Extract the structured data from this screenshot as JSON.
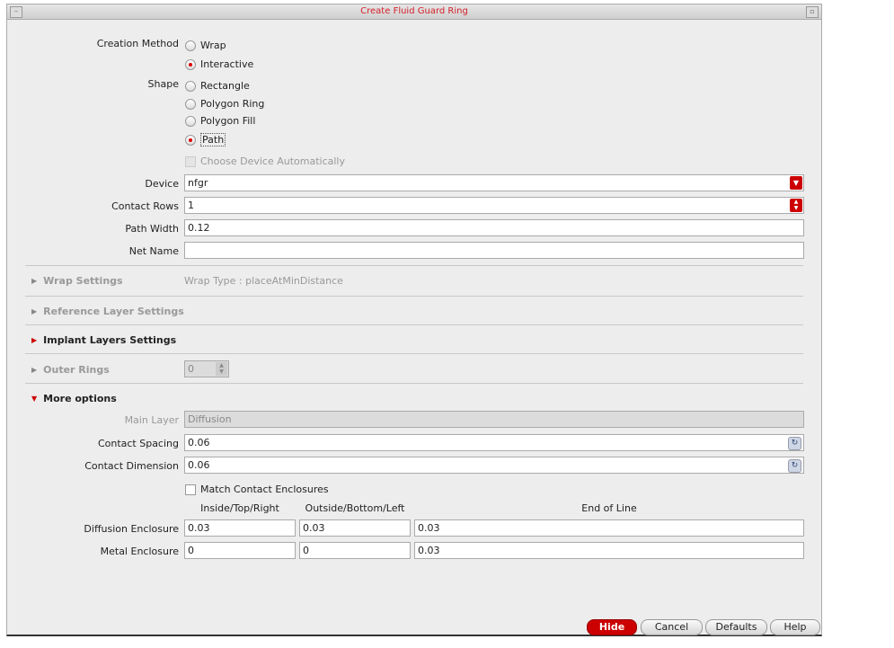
{
  "window": {
    "title": "Create Fluid Guard Ring"
  },
  "creation_method": {
    "label": "Creation Method",
    "options": [
      "Wrap",
      "Interactive"
    ],
    "selected": "Interactive"
  },
  "shape": {
    "label": "Shape",
    "options": [
      "Rectangle",
      "Polygon Ring",
      "Polygon Fill",
      "Path"
    ],
    "selected": "Path"
  },
  "choose_device": "Choose Device Automatically",
  "device": {
    "label": "Device",
    "value": "nfgr"
  },
  "contact_rows": {
    "label": "Contact Rows",
    "value": "1"
  },
  "path_width": {
    "label": "Path Width",
    "value": "0.12"
  },
  "net_name": {
    "label": "Net Name",
    "value": ""
  },
  "sections": {
    "wrap": "Wrap Settings",
    "wrap_type": "Wrap Type : placeAtMinDistance",
    "reference": "Reference Layer Settings",
    "implant": "Implant Layers Settings",
    "outer_rings": "Outer Rings",
    "outer_rings_value": "0",
    "more": "More options"
  },
  "more": {
    "main_layer": {
      "label": "Main Layer",
      "value": "Diffusion"
    },
    "contact_spacing": {
      "label": "Contact Spacing",
      "value": "0.06"
    },
    "contact_dimension": {
      "label": "Contact Dimension",
      "value": "0.06"
    },
    "match": "Match Contact Enclosures",
    "headers": [
      "Inside/Top/Right",
      "Outside/Bottom/Left",
      "End of Line"
    ],
    "diffusion": {
      "label": "Diffusion Enclosure",
      "values": [
        "0.03",
        "0.03",
        "0.03"
      ]
    },
    "metal": {
      "label": "Metal Enclosure",
      "values": [
        "0",
        "0",
        "0.03"
      ]
    }
  },
  "buttons": {
    "hide": "Hide",
    "cancel": "Cancel",
    "defaults": "Defaults",
    "help": "Help"
  }
}
